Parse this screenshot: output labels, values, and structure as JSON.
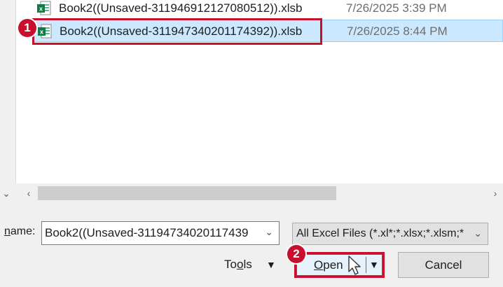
{
  "files": [
    {
      "name": "Book2((Unsaved-311946912127080512)).xlsb",
      "date": "7/26/2025 3:39 PM",
      "icon": "excel-file-icon"
    },
    {
      "name": "Book2((Unsaved-311947340201174392)).xlsb",
      "date": "7/26/2025 8:44 PM",
      "icon": "excel-file-icon"
    }
  ],
  "annotations": {
    "step1": "1",
    "step2": "2",
    "highlight_color": "#c8102e"
  },
  "file_name": {
    "label_prefix": "",
    "label_underlined": "n",
    "label_rest": "ame:",
    "value": "Book2((Unsaved-3119473402011743​9"
  },
  "file_type": {
    "value": "All Excel Files (*.xl*;*.xlsx;*.xlsm;*"
  },
  "buttons": {
    "tools_pre": "To",
    "tools_ul": "o",
    "tools_post": "ls",
    "open_ul": "O",
    "open_rest": "pen",
    "cancel": "Cancel"
  },
  "colors": {
    "selection": "#cce8ff",
    "accent": "#0078d7"
  }
}
